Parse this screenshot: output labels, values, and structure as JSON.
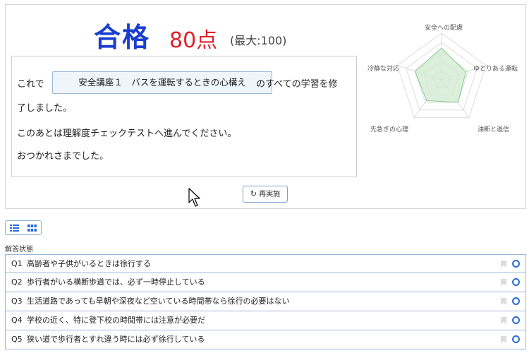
{
  "result": {
    "pass_label": "合格",
    "score": "80点",
    "max_score": "(最大:100)"
  },
  "message": {
    "line1_prefix": "これで",
    "course_name": "安全講座１　バスを運転するときの心構え",
    "line1_suffix": "のすべての学習を修",
    "line2": "了しました。",
    "line3": "このあとは理解度チェックテストへ進んでください。",
    "line4": "おつかれさまでした。"
  },
  "redo_button": {
    "icon": "redo-icon",
    "label": "再実施"
  },
  "radar": {
    "labels": [
      "安全への配慮",
      "ゆとりある運転",
      "油断と過信",
      "先急ぎの心理",
      "冷静な対応"
    ],
    "scores": [
      0.68,
      0.55,
      0.6,
      0.55,
      0.6
    ],
    "fill_color": "#d3ead3",
    "stroke_color": "#8cc98c",
    "grid_color": "#dddddd"
  },
  "view_toggle": {
    "list_icon": "list-view-icon",
    "grid_icon": "grid-view-icon"
  },
  "answer_status": {
    "label": "解答状態",
    "items": [
      {
        "num": "Q1",
        "text": "高齢者や子供がいるときは徐行する"
      },
      {
        "num": "Q2",
        "text": "歩行者がいる横断歩道では、必ず一時停止している"
      },
      {
        "num": "Q3",
        "text": "生活道路であっても早朝や深夜など空いている時間帯なら徐行の必要はない"
      },
      {
        "num": "Q4",
        "text": "学校の近く、特に登下校の時間帯には注意が必要だ"
      },
      {
        "num": "Q5",
        "text": "狭い道で歩行者とすれ違う時には必ず徐行している"
      }
    ]
  },
  "colors": {
    "pass": "#1a3fd0",
    "score": "#e0202a",
    "accent_border": "#9fb8d8",
    "status_circle": "#2a6ad9"
  }
}
